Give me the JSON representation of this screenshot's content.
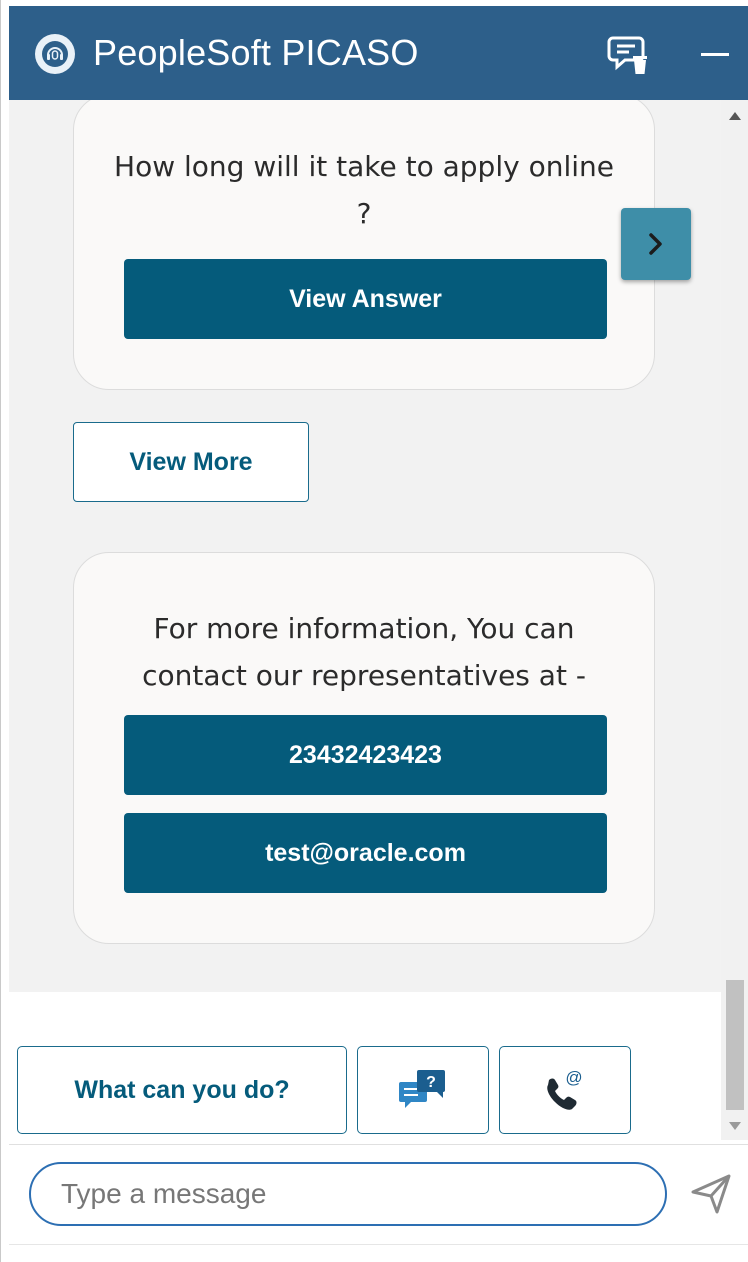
{
  "header": {
    "title": "PeopleSoft PICASO",
    "logo_icon": "headset-icon",
    "clear_icon": "clear-chat-icon",
    "minimize_icon": "minimize-icon",
    "bg_color": "#2d5f8a"
  },
  "messages": {
    "faq_card": {
      "question": "How long will it take to apply online ?",
      "button_label": "View Answer"
    },
    "next_icon": "chevron-right-icon",
    "view_more_label": "View More",
    "contact_card": {
      "text": "For more information, You can contact our representatives at -",
      "phone_label": "23432423423",
      "email_label": "test@oracle.com"
    }
  },
  "quick_actions": {
    "what_can_you_do_label": "What can you do?",
    "faq_icon": "faq-chat-icon",
    "faq_icon_glyph": "?",
    "contact_icon": "phone-email-icon",
    "contact_icon_glyph": "@"
  },
  "input": {
    "placeholder": "Type a message",
    "send_icon": "send-icon"
  },
  "colors": {
    "primary_button": "#055b7b",
    "next_button": "#3e8ea8",
    "chat_bg": "#f2f2f2",
    "card_bg": "#faf9f8"
  }
}
